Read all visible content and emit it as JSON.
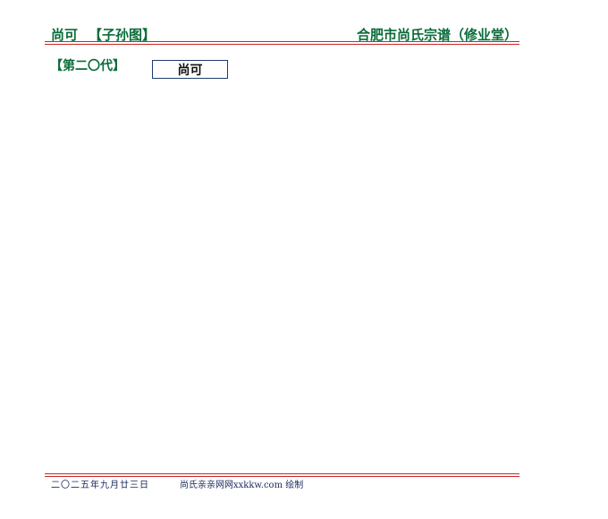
{
  "header": {
    "person_name": "尚可",
    "chart_type": "【子孙图】",
    "site_title": "合肥市尚氏宗谱（修业堂）"
  },
  "generation": {
    "label": "【第二〇代】",
    "members": [
      "尚可"
    ]
  },
  "footer": {
    "date": "二〇二五年九月廿三日",
    "credit": "尚氏亲亲网网xxkkw.com 绘制"
  },
  "colors": {
    "title_green": "#0a6b3a",
    "rule_red": "#c62828",
    "box_border": "#1f3b6b",
    "footer_text": "#1a2a5a"
  }
}
